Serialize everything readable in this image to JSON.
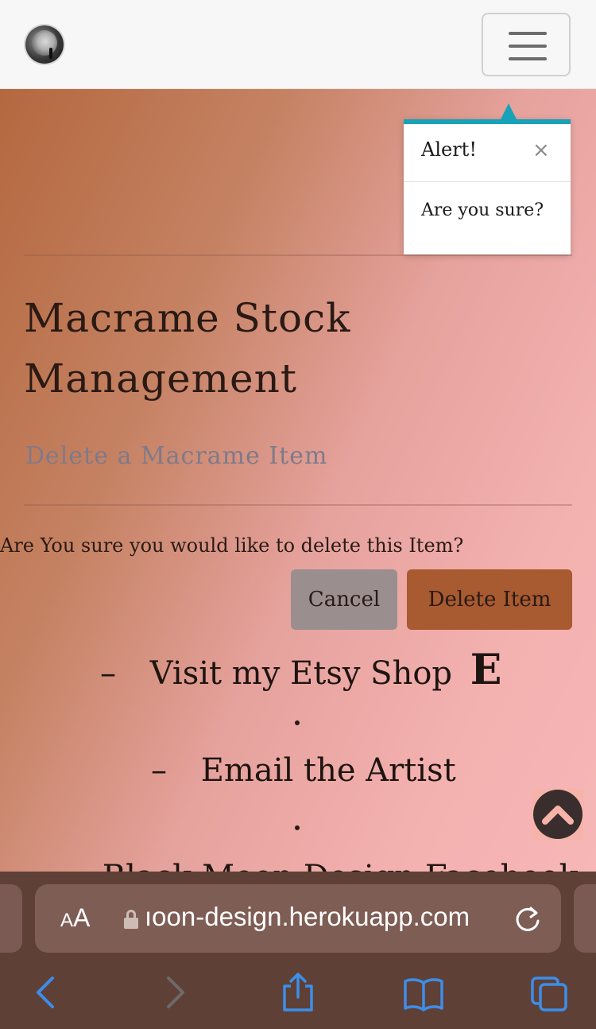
{
  "navbar": {
    "logo_icon": "moon-cactus-logo-icon",
    "menu_icon": "hamburger-menu-icon"
  },
  "popover": {
    "title": "Alert!",
    "close_glyph": "×",
    "body": "Are you sure?",
    "accent_color": "#17a2b8"
  },
  "page": {
    "title": "Macrame Stock Management",
    "subtitle": "Delete a Macrame Item",
    "question": "Are You sure you would like to delete this Item?"
  },
  "buttons": {
    "cancel": "Cancel",
    "delete": "Delete Item"
  },
  "footer": {
    "etsy_prefix": "–",
    "etsy_label": "Visit my Etsy Shop",
    "etsy_glyph": "E",
    "email_prefix": "–",
    "email_label": "Email the Artist",
    "separator": ".",
    "cutoff_text": "– Black Moon Design Facebook"
  },
  "scroll_top_icon": "chevron-up-icon",
  "browser": {
    "text_size_small": "A",
    "text_size_big": "A",
    "url": "ıoon-design.herokuapp.com",
    "icons": [
      "back-icon",
      "forward-icon",
      "share-icon",
      "bookmarks-icon",
      "tabs-icon"
    ]
  },
  "colors": {
    "delete_button": "#a85a30",
    "cancel_button": "#9a8e8e",
    "safari_bar": "#5e4037",
    "toolbar_icon": "#3d8ee8"
  }
}
